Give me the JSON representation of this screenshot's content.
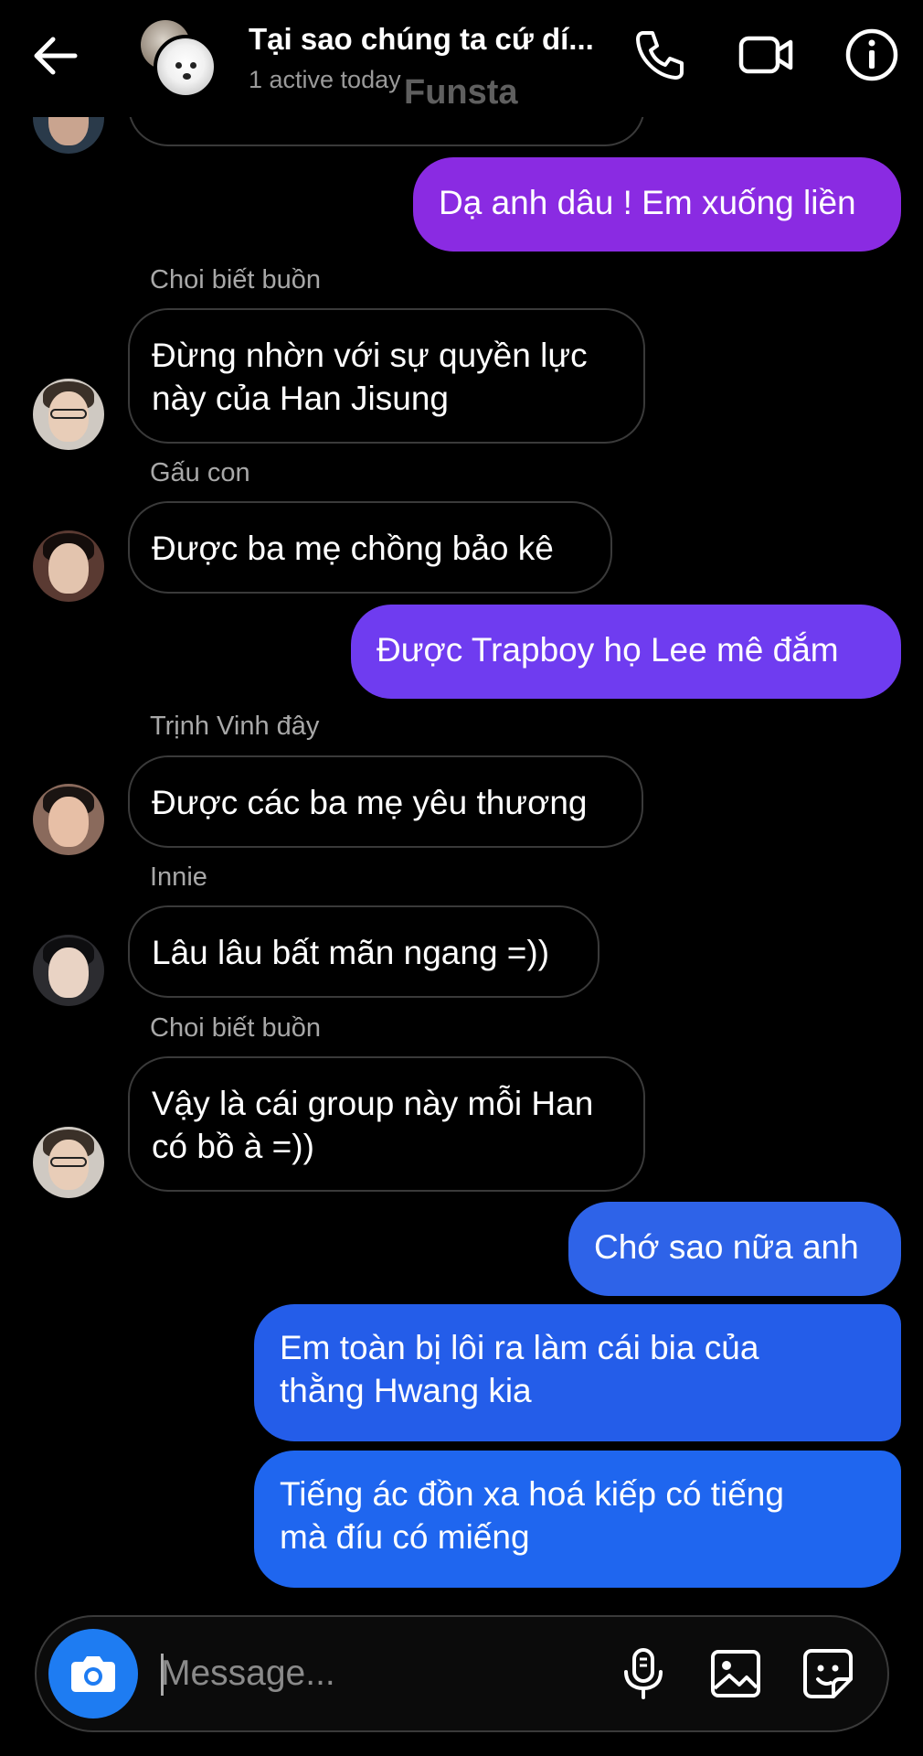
{
  "header": {
    "title": "Tại sao chúng ta cứ dí...",
    "subtitle": "1 active today",
    "watermark": "Funsta"
  },
  "messages": [
    {
      "sender": "Choi biết buồn",
      "lines": [
        "Đừng nhờn với sự quyền lực",
        "này của Han Jisung"
      ]
    },
    {
      "sender": "Gấu con",
      "lines": [
        "Được ba mẹ chồng bảo kê"
      ]
    },
    {
      "sender": "Trịnh Vinh đây",
      "lines": [
        "Được các ba mẹ yêu thương"
      ]
    },
    {
      "sender": "Innie",
      "lines": [
        "Lâu lâu bất mãn ngang =))"
      ]
    },
    {
      "sender": "Choi biết buồn",
      "lines": [
        "Vậy là cái group này mỗi Han",
        "có bồ à =))"
      ]
    }
  ],
  "outgoing": [
    {
      "text": "Dạ anh dâu ! Em xuống liền"
    },
    {
      "text": "Được Trapboy họ Lee mê đắm"
    },
    {
      "text": "Chớ sao nữa anh"
    },
    {
      "lines": [
        "Em toàn bị lôi ra làm cái bia của",
        "thằng Hwang kia"
      ]
    },
    {
      "lines": [
        "Tiếng ác đồn xa hoá kiếp có tiếng",
        "mà đíu có miếng"
      ]
    }
  ],
  "composer": {
    "placeholder": "Message..."
  },
  "icons": {
    "back": "arrow-left-icon",
    "call": "phone-icon",
    "video": "video-camera-icon",
    "info": "info-icon",
    "camera": "camera-icon",
    "mic": "microphone-icon",
    "gallery": "image-icon",
    "sticker": "sticker-icon"
  },
  "colors": {
    "background": "#000000",
    "outgoing_purple": "#8a2be2",
    "outgoing_violet": "#6f3cf0",
    "outgoing_blue": "#2e63e8",
    "outgoing_bright_blue": "#1f66ef",
    "camera_button": "#1e7cf2",
    "incoming_border": "#3a3a3a"
  }
}
